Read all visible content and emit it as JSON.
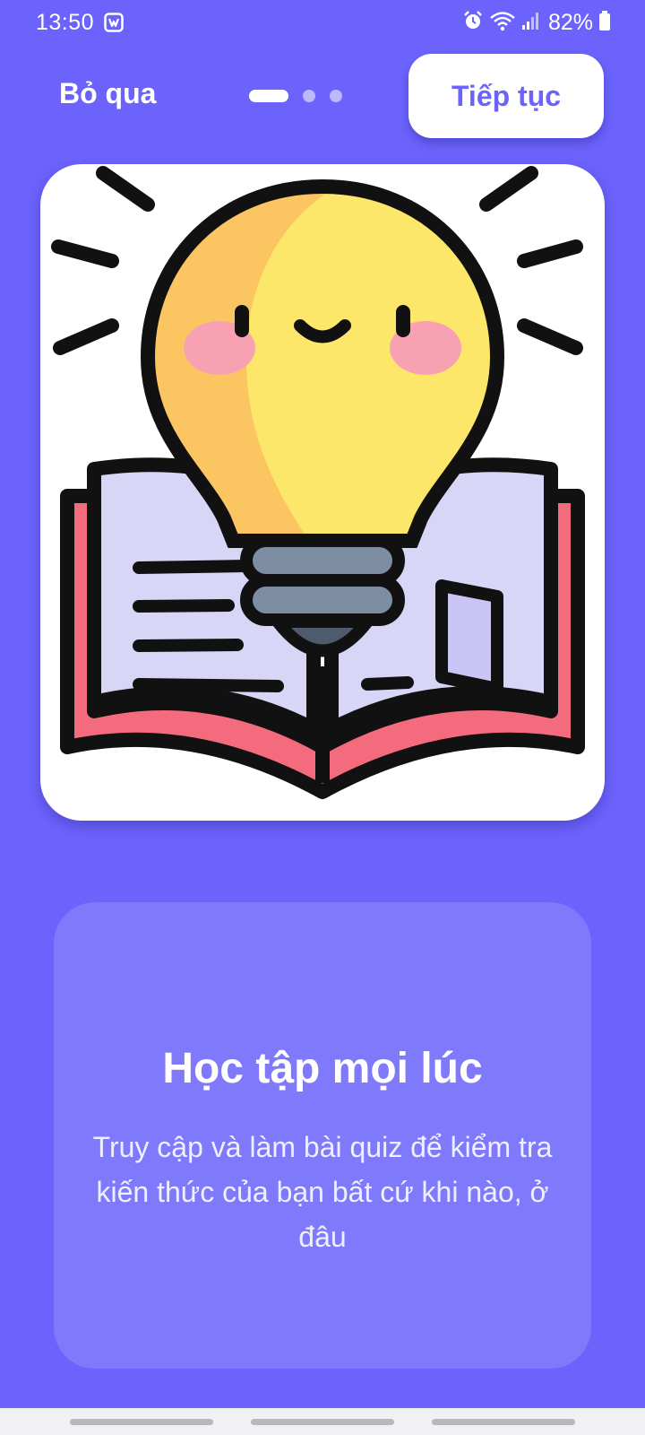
{
  "status_bar": {
    "time": "13:50",
    "battery": "82%",
    "app_icon": "messenger-icon",
    "icons": [
      "alarm-icon",
      "wifi-icon",
      "signal-icon",
      "battery-icon"
    ]
  },
  "header": {
    "skip_label": "Bỏ qua",
    "continue_label": "Tiếp tục",
    "page_indicator": {
      "total": 3,
      "active_index": 0
    }
  },
  "illustration": {
    "icon": "lightbulb-book-icon"
  },
  "info": {
    "title": "Học tập mọi lúc",
    "description": "Truy cập và làm bài quiz để kiểm tra kiến thức của bạn bất cứ khi nào, ở đâu"
  },
  "colors": {
    "background": "#6b63fb",
    "accent": "#6b63fb",
    "card": "#ffffff",
    "bulb": "#fde76a",
    "bulb_shade": "#fbc561",
    "cheek": "#f7a1b3",
    "book_page": "#d8d6f6",
    "book_cover": "#f56b7e",
    "bulb_base": "#7d8ea3"
  }
}
